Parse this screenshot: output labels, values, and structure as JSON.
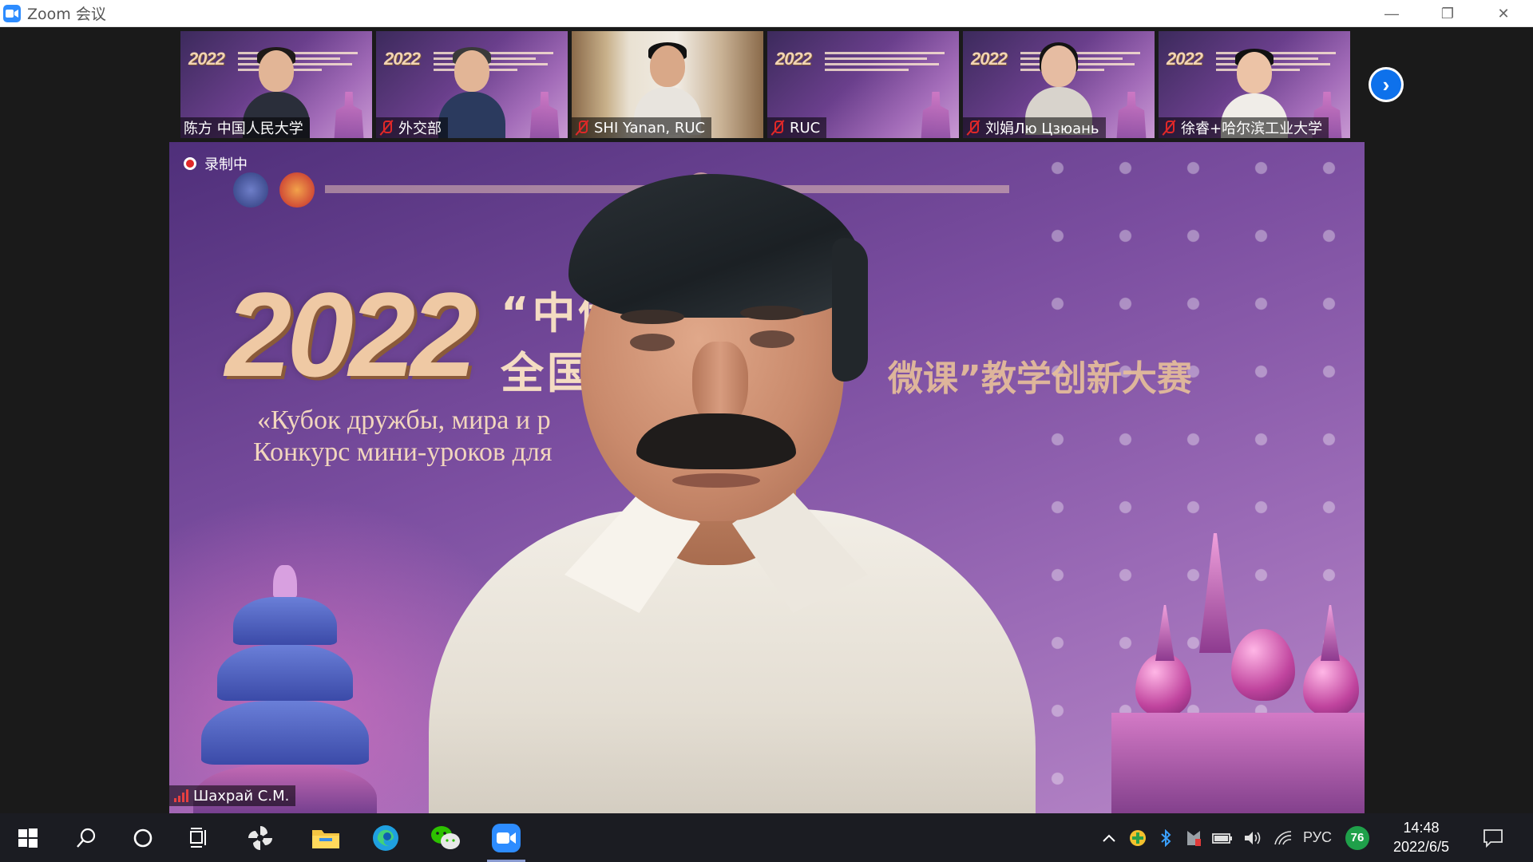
{
  "window": {
    "title": "Zoom 会议",
    "controls": {
      "minimize": "—",
      "restore": "❐",
      "close": "✕"
    }
  },
  "recording": {
    "label": "录制中"
  },
  "thumbnails": [
    {
      "name": "陈方 中国人民大学",
      "muted": false,
      "scene": "banner"
    },
    {
      "name": "外交部",
      "muted": true,
      "scene": "banner"
    },
    {
      "name": "SHI Yanan, RUC",
      "muted": true,
      "scene": "room"
    },
    {
      "name": "RUC",
      "muted": true,
      "scene": "banner"
    },
    {
      "name": "刘娟Лю Цзюань",
      "muted": true,
      "scene": "banner"
    },
    {
      "name": "徐睿+哈尔滨工业大学",
      "muted": true,
      "scene": "banner"
    }
  ],
  "thumb_banner": {
    "year": "2022"
  },
  "main_video": {
    "speaker_name": "Шахрай С.М.",
    "background": {
      "year": "2022",
      "line_cn_1": "“中俄",
      "line_cn_2": "全国高",
      "line_cn_3": "微课”教学创新大赛",
      "line_ru_1": "«Кубок дружбы, мира и р",
      "line_ru_2": "Конкурс мини-уроков для"
    }
  },
  "taskbar": {
    "apps": [
      "start-icon",
      "search-icon",
      "cortana-icon",
      "task-view-icon",
      "pinwheel-app-icon",
      "file-explorer-icon",
      "edge-icon",
      "wechat-icon",
      "zoom-icon"
    ],
    "tray": {
      "language": "РУС",
      "badge": "76",
      "time": "14:48",
      "date": "2022/6/5"
    }
  },
  "colors": {
    "zoom_blue": "#2d8cff",
    "muted_red": "#e02828",
    "taskbar": "#1b1c22"
  }
}
